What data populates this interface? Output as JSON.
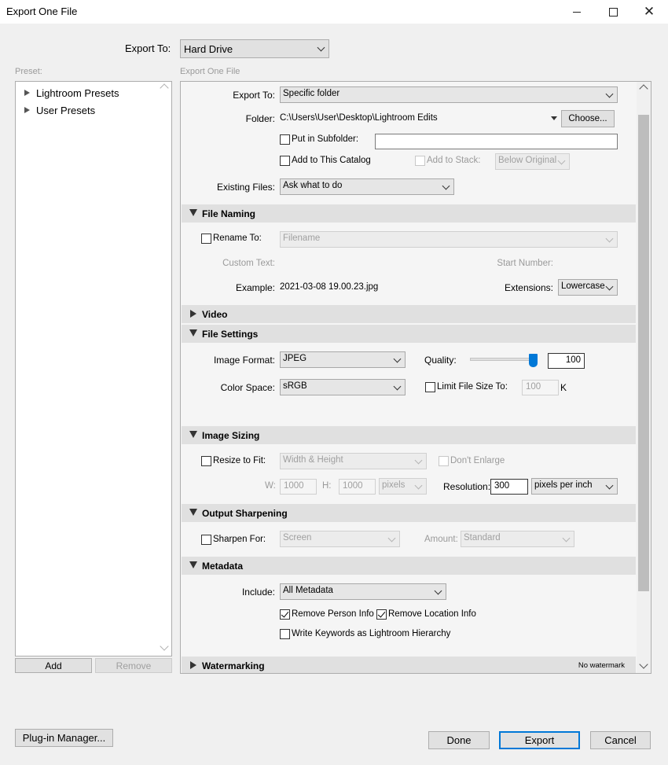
{
  "window": {
    "title": "Export One File"
  },
  "export_to_top": {
    "label": "Export To:",
    "value": "Hard Drive"
  },
  "preset": {
    "label": "Preset:",
    "items": [
      "Lightroom Presets",
      "User Presets"
    ],
    "add_label": "Add",
    "remove_label": "Remove"
  },
  "main_label": "Export One File",
  "location": {
    "export_to_label": "Export To:",
    "export_to_value": "Specific folder",
    "folder_label": "Folder:",
    "folder_path": "C:\\Users\\User\\Desktop\\Lightroom Edits",
    "choose_label": "Choose...",
    "subfolder_label": "Put in Subfolder:",
    "subfolder_value": "",
    "add_catalog_label": "Add to This Catalog",
    "add_stack_label": "Add to Stack:",
    "stack_position": "Below Original",
    "existing_label": "Existing Files:",
    "existing_value": "Ask what to do"
  },
  "file_naming": {
    "title": "File Naming",
    "rename_label": "Rename To:",
    "rename_value": "Filename",
    "custom_text_label": "Custom Text:",
    "start_number_label": "Start Number:",
    "example_label": "Example:",
    "example_value": "2021-03-08 19.00.23.jpg",
    "extensions_label": "Extensions:",
    "extensions_value": "Lowercase"
  },
  "video": {
    "title": "Video"
  },
  "file_settings": {
    "title": "File Settings",
    "format_label": "Image Format:",
    "format_value": "JPEG",
    "quality_label": "Quality:",
    "quality_value": "100",
    "quality_fraction": 1.0,
    "color_space_label": "Color Space:",
    "color_space_value": "sRGB",
    "limit_label": "Limit File Size To:",
    "limit_value": "100",
    "limit_unit": "K"
  },
  "image_sizing": {
    "title": "Image Sizing",
    "resize_label": "Resize to Fit:",
    "resize_value": "Width & Height",
    "dont_enlarge_label": "Don't Enlarge",
    "w_label": "W:",
    "w_value": "1000",
    "h_label": "H:",
    "h_value": "1000",
    "units_value": "pixels",
    "resolution_label": "Resolution:",
    "resolution_value": "300",
    "resolution_unit": "pixels per inch"
  },
  "output_sharpening": {
    "title": "Output Sharpening",
    "sharpen_label": "Sharpen For:",
    "sharpen_value": "Screen",
    "amount_label": "Amount:",
    "amount_value": "Standard"
  },
  "metadata": {
    "title": "Metadata",
    "include_label": "Include:",
    "include_value": "All Metadata",
    "remove_person_label": "Remove Person Info",
    "remove_location_label": "Remove Location Info",
    "keywords_label": "Write Keywords as Lightroom Hierarchy"
  },
  "watermarking": {
    "title": "Watermarking",
    "status": "No watermark"
  },
  "footer": {
    "plugin_label": "Plug-in Manager...",
    "done_label": "Done",
    "export_label": "Export",
    "cancel_label": "Cancel"
  },
  "colors": {
    "accent": "#0078d7",
    "section_bg": "#e0e0e0",
    "window_bg": "#f0f0f0"
  }
}
